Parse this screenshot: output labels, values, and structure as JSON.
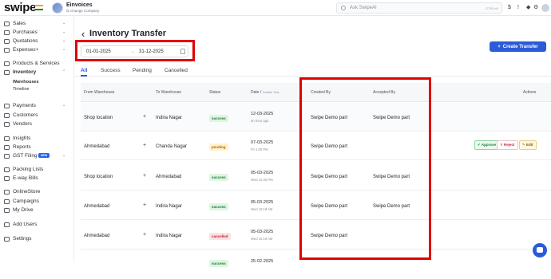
{
  "brand": {
    "logo": "swipe"
  },
  "company": {
    "name": "Einvoices",
    "change_label": "⇆ Change Company"
  },
  "search": {
    "placeholder": "Ask SwipeAI",
    "shortcut": "CTRL+K"
  },
  "topbar_icons": [
    "dollar-icon",
    "warning-icon",
    "bell-icon",
    "settings-icon"
  ],
  "sidebar": {
    "items": [
      {
        "label": "Sales",
        "chevron": "⌄"
      },
      {
        "label": "Purchases",
        "chevron": "⌄"
      },
      {
        "label": "Quotations",
        "chevron": "⌄"
      },
      {
        "label": "Expenses+",
        "chevron": "⌄"
      },
      {
        "label": "Products & Services"
      },
      {
        "label": "Inventory",
        "chevron": "⌃"
      },
      {
        "label": "Payments",
        "chevron": "⌄"
      },
      {
        "label": "Customers"
      },
      {
        "label": "Vendors"
      },
      {
        "label": "Insights"
      },
      {
        "label": "Reports"
      },
      {
        "label": "GST Filing",
        "badge": "NEW",
        "chevron": "⌄"
      },
      {
        "label": "Packing Lists"
      },
      {
        "label": "E-way Bills"
      },
      {
        "label": "OnlineStore"
      },
      {
        "label": "Campaigns"
      },
      {
        "label": "My Drive"
      },
      {
        "label": "Add Users"
      },
      {
        "label": "Settings"
      }
    ],
    "inventory_subitems": [
      "Warehouses",
      "Timeline"
    ]
  },
  "page": {
    "back": "‹",
    "title": "Inventory Transfer",
    "create_button": "Create Transfer",
    "date_from": "01-01-2025",
    "date_arrow": "→",
    "date_to": "31-12-2025"
  },
  "tabs": [
    "All",
    "Success",
    "Pending",
    "Cancelled"
  ],
  "table": {
    "headers": {
      "from": "From Warehouse",
      "to": "To Warehouse",
      "status": "Status",
      "date": "Date /",
      "date_sub": "Created Time",
      "created_by": "Created By",
      "accepted_by": "Accepted By",
      "actions": "Actions"
    },
    "rows": [
      {
        "from": "Shop location",
        "to": "Indira Nagar",
        "status": "success",
        "date": "12-03-2025",
        "time": "an hour ago",
        "created_by": "Swipe Demo part",
        "accepted_by": "Swipe Demo part"
      },
      {
        "from": "Ahmedabad",
        "to": "Chanda Nagar",
        "status": "pending",
        "date": "07-03-2025",
        "time": "Fri 1:00 PM",
        "created_by": "Swipe Demo part",
        "accepted_by": ""
      },
      {
        "from": "Shop location",
        "to": "Ahmedabad",
        "status": "success",
        "date": "05-03-2025",
        "time": "Wed 12:46 PM",
        "created_by": "Swipe Demo part",
        "accepted_by": "Swipe Demo part"
      },
      {
        "from": "Ahmedabad",
        "to": "Indira Nagar",
        "status": "success",
        "date": "05-03-2025",
        "time": "Wed 10:19 AM",
        "created_by": "Swipe Demo part",
        "accepted_by": "Swipe Demo part"
      },
      {
        "from": "Ahmedabad",
        "to": "Indira Nagar",
        "status": "cancelled",
        "date": "05-03-2025",
        "time": "Wed 10:19 AM",
        "created_by": "Swipe Demo part",
        "accepted_by": ""
      },
      {
        "from": "",
        "to": "",
        "status": "success",
        "date": "25-02-2025",
        "time": "",
        "created_by": "",
        "accepted_by": ""
      }
    ],
    "row_actions": {
      "approve": "✔ Approve",
      "reject": "✕ Reject",
      "edit": "✎ Edit"
    }
  },
  "colors": {
    "accent": "#2b5bd7",
    "highlight": "#e00000"
  }
}
